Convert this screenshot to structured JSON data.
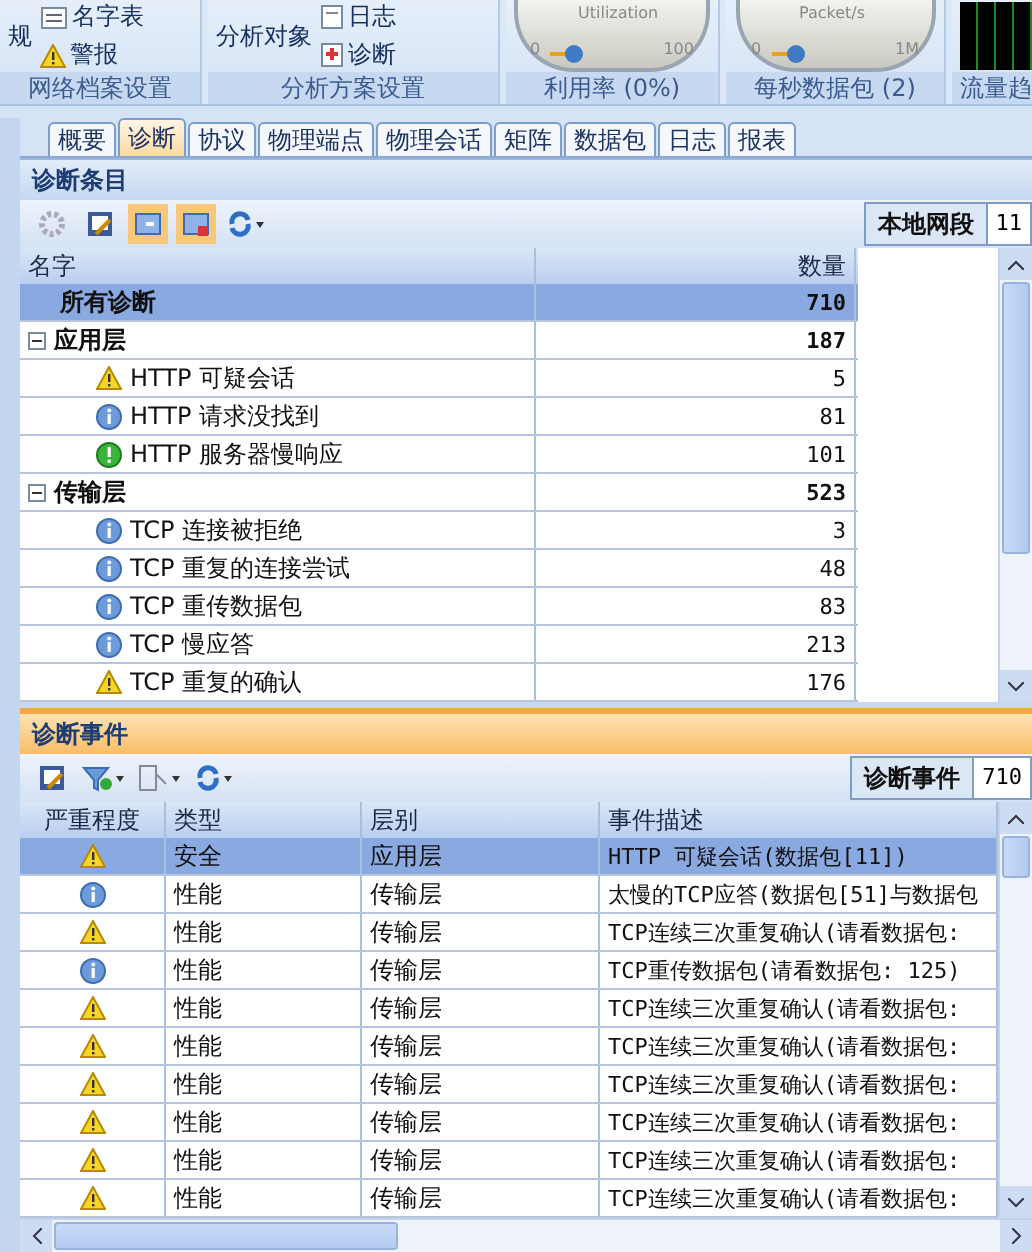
{
  "ribbon": {
    "groups": [
      {
        "kind": "buttons",
        "label": "网络档案设置",
        "items": [
          {
            "text": "规"
          },
          {
            "text": "名字表"
          },
          {
            "text": "警报"
          }
        ]
      },
      {
        "kind": "buttons",
        "label": "分析方案设置",
        "items": [
          {
            "text": "分析对象"
          },
          {
            "text": "日志"
          },
          {
            "text": "诊断"
          }
        ]
      },
      {
        "kind": "gauge",
        "label": "利用率 (0%)",
        "title": "Utilization",
        "min": "0",
        "max": "100"
      },
      {
        "kind": "gauge",
        "label": "每秒数据包 (2)",
        "title": "Packet/s",
        "min": "0",
        "max": "1M"
      },
      {
        "kind": "trend",
        "label": "流量趋"
      }
    ]
  },
  "tabs": [
    {
      "label": "概要",
      "selected": false
    },
    {
      "label": "诊断",
      "selected": true
    },
    {
      "label": "协议",
      "selected": false
    },
    {
      "label": "物理端点",
      "selected": false
    },
    {
      "label": "物理会话",
      "selected": false
    },
    {
      "label": "矩阵",
      "selected": false
    },
    {
      "label": "数据包",
      "selected": false
    },
    {
      "label": "日志",
      "selected": false
    },
    {
      "label": "报表",
      "selected": false
    }
  ],
  "entries": {
    "title": "诊断条目",
    "segment_label": "本地网段",
    "segment_value": "11",
    "columns": [
      "名字",
      "数量"
    ],
    "root": {
      "name": "所有诊断",
      "count": "710",
      "selected": true
    },
    "groups": [
      {
        "name": "应用层",
        "count": "187",
        "expanded": true,
        "selected": false,
        "children": [
          {
            "kind": "warning",
            "name": "HTTP 可疑会话",
            "count": "5",
            "selected": false
          },
          {
            "kind": "info",
            "name": "HTTP 请求没找到",
            "count": "81",
            "selected": false
          },
          {
            "kind": "notice",
            "name": "HTTP 服务器慢响应",
            "count": "101",
            "selected": false
          }
        ]
      },
      {
        "name": "传输层",
        "count": "523",
        "expanded": true,
        "selected": false,
        "children": [
          {
            "kind": "info",
            "name": "TCP 连接被拒绝",
            "count": "3",
            "selected": false
          },
          {
            "kind": "info",
            "name": "TCP 重复的连接尝试",
            "count": "48",
            "selected": false
          },
          {
            "kind": "info",
            "name": "TCP 重传数据包",
            "count": "83",
            "selected": false
          },
          {
            "kind": "info",
            "name": "TCP 慢应答",
            "count": "213",
            "selected": false
          },
          {
            "kind": "warning",
            "name": "TCP 重复的确认",
            "count": "176",
            "selected": false
          }
        ]
      }
    ]
  },
  "events": {
    "title": "诊断事件",
    "count_label": "诊断事件",
    "count_value": "710",
    "columns": [
      "严重程度",
      "类型",
      "层别",
      "事件描述"
    ],
    "rows": [
      {
        "kind": "warning",
        "type": "安全",
        "layer": "应用层",
        "description": "HTTP 可疑会话(数据包[11])",
        "selected": true
      },
      {
        "kind": "info",
        "type": "性能",
        "layer": "传输层",
        "description": "太慢的TCP应答(数据包[51]与数据包",
        "selected": false
      },
      {
        "kind": "warning",
        "type": "性能",
        "layer": "传输层",
        "description": "TCP连续三次重复确认(请看数据包:",
        "selected": false
      },
      {
        "kind": "info",
        "type": "性能",
        "layer": "传输层",
        "description": "TCP重传数据包(请看数据包: 125)",
        "selected": false
      },
      {
        "kind": "warning",
        "type": "性能",
        "layer": "传输层",
        "description": "TCP连续三次重复确认(请看数据包:",
        "selected": false
      },
      {
        "kind": "warning",
        "type": "性能",
        "layer": "传输层",
        "description": "TCP连续三次重复确认(请看数据包:",
        "selected": false
      },
      {
        "kind": "warning",
        "type": "性能",
        "layer": "传输层",
        "description": "TCP连续三次重复确认(请看数据包:",
        "selected": false
      },
      {
        "kind": "warning",
        "type": "性能",
        "layer": "传输层",
        "description": "TCP连续三次重复确认(请看数据包:",
        "selected": false
      },
      {
        "kind": "warning",
        "type": "性能",
        "layer": "传输层",
        "description": "TCP连续三次重复确认(请看数据包:",
        "selected": false
      },
      {
        "kind": "warning",
        "type": "性能",
        "layer": "传输层",
        "description": "TCP连续三次重复确认(请看数据包:",
        "selected": false
      }
    ]
  }
}
